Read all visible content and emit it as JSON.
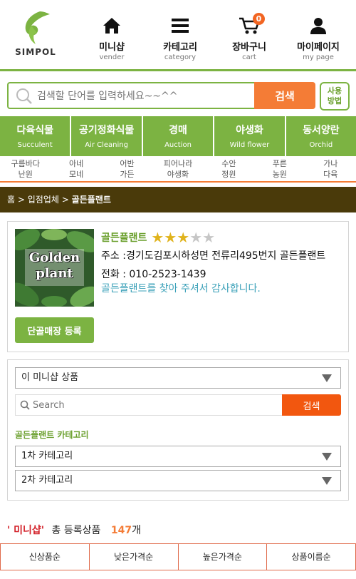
{
  "header": {
    "logo_text": "SIMPOL",
    "nav": [
      {
        "ko": "미니샵",
        "en": "vender",
        "icon": "home-icon"
      },
      {
        "ko": "카테고리",
        "en": "category",
        "icon": "menu-icon"
      },
      {
        "ko": "장바구니",
        "en": "cart",
        "icon": "cart-icon",
        "badge": "0"
      },
      {
        "ko": "마이페이지",
        "en": "my page",
        "icon": "user-icon"
      }
    ]
  },
  "search": {
    "placeholder": "검색할 단어를 입력하세요~~^^",
    "button": "검색",
    "howto_line1": "사용",
    "howto_line2": "방법"
  },
  "categories": [
    {
      "ko": "다육식물",
      "en": "Succulent"
    },
    {
      "ko": "공기정화식물",
      "en": "Air Cleaning"
    },
    {
      "ko": "경매",
      "en": "Auction"
    },
    {
      "ko": "야생화",
      "en": "Wild flower"
    },
    {
      "ko": "동서양란",
      "en": "Orchid"
    }
  ],
  "sub_categories": [
    {
      "l1": "구름바다",
      "l2": "난원"
    },
    {
      "l1": "아네",
      "l2": "모네"
    },
    {
      "l1": "어반",
      "l2": "가든"
    },
    {
      "l1": "피어나라",
      "l2": "야생화"
    },
    {
      "l1": "수안",
      "l2": "정원"
    },
    {
      "l1": "푸른",
      "l2": "농원"
    },
    {
      "l1": "가나",
      "l2": "다육"
    }
  ],
  "breadcrumb": {
    "home": "홈",
    "sep1": ">",
    "vendors": "입점업체",
    "sep2": ">",
    "current": "골든플랜트"
  },
  "shop": {
    "image_text_line1": "Golden",
    "image_text_line2": "plant",
    "name": "골든플랜트",
    "rating": 3,
    "rating_max": 5,
    "address_label": "주소 : ",
    "address": "경기도김포시하성면 전류리495번지 골든플랜트",
    "phone_label": "전화 : ",
    "phone": "010-2523-1439",
    "thanks": "골든플랜트를 찾아 주셔서 감사합니다.",
    "register_button": "단골매장 등록"
  },
  "filter": {
    "scope_select": "이 미니샵 상품",
    "search_placeholder": "Search",
    "search_button": "검색",
    "shop_category_label": "골든플랜트 카테고리",
    "cat1_select": "1차 카테고리",
    "cat2_select": "2차 카테고리"
  },
  "stats": {
    "miniShop": "' 미니샵'",
    "label": "총 등록상품",
    "count": "147",
    "unit": "개"
  },
  "sort": [
    "신상품순",
    "낮은가격순",
    "높은가격순",
    "상품이름순"
  ],
  "colors": {
    "brand_green": "#7cb342",
    "accent_orange": "#f47c36",
    "breadcrumb_bg": "#4a3a0a"
  }
}
